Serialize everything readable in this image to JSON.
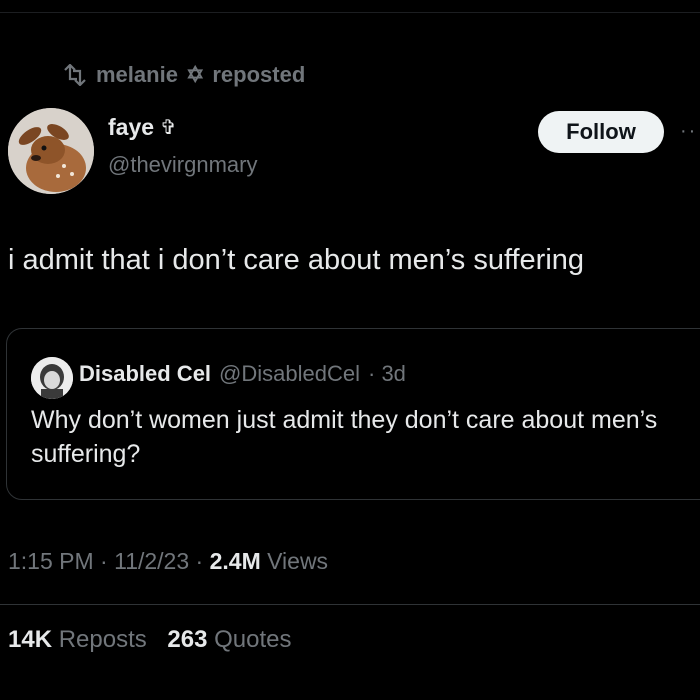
{
  "repost": {
    "user": "melanie",
    "symbol": "✡",
    "label": "reposted",
    "icon": "repost-icon"
  },
  "author": {
    "name": "faye",
    "badge": "✞",
    "handle": "@thevirgnmary",
    "avatar": "fawn-avatar"
  },
  "follow_label": "Follow",
  "more_icon": "more-options-icon",
  "tweet_text": "i admit that i don’t care about men’s suffering",
  "quote": {
    "name": "Disabled Cel",
    "handle": "@DisabledCel",
    "time": "· 3d",
    "text": "Why don’t women just admit they don’t care about men’s suffering?",
    "avatar": "profile-avatar"
  },
  "meta": {
    "time": "1:15 PM",
    "sep1": "·",
    "date": "11/2/23",
    "sep2": "·",
    "views_count": "2.4M",
    "views_label": "Views"
  },
  "stats": {
    "reposts_count": "14K",
    "reposts_label": "Reposts",
    "quotes_count": "263",
    "quotes_label": "Quotes"
  },
  "colors": {
    "background": "#000000",
    "text": "#e7e9ea",
    "muted": "#71767b",
    "border": "#2f3336",
    "button": "#eff3f4"
  }
}
